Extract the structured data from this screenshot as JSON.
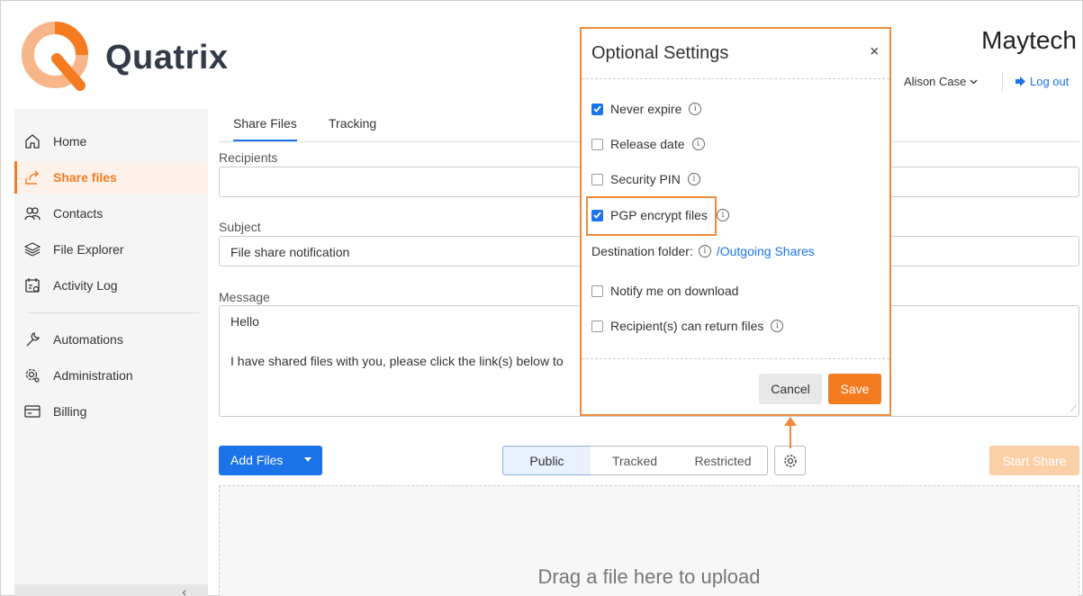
{
  "app": {
    "logo_text": "Quatrix",
    "brand": "Maytech",
    "user_name": "Alison Case",
    "logout_label": "Log out"
  },
  "sidebar": {
    "items": [
      {
        "label": "Home",
        "icon": "home-icon"
      },
      {
        "label": "Share files",
        "icon": "share-icon",
        "active": true
      },
      {
        "label": "Contacts",
        "icon": "contacts-icon"
      },
      {
        "label": "File Explorer",
        "icon": "layers-icon"
      },
      {
        "label": "Activity Log",
        "icon": "activity-log-icon"
      },
      {
        "label": "Automations",
        "icon": "wrench-icon"
      },
      {
        "label": "Administration",
        "icon": "gear-icon"
      },
      {
        "label": "Billing",
        "icon": "billing-icon"
      }
    ],
    "collapse_glyph": "‹"
  },
  "tabs": [
    {
      "label": "Share Files",
      "active": true
    },
    {
      "label": "Tracking"
    }
  ],
  "form": {
    "recipients_label": "Recipients",
    "recipients_value": "",
    "subject_label": "Subject",
    "subject_value": "File share notification",
    "message_label": "Message",
    "message_line1": "Hello",
    "message_line2": "I have shared files with you, please click the link(s) below to"
  },
  "actions": {
    "add_files": "Add Files",
    "segments": [
      "Public",
      "Tracked",
      "Restricted"
    ],
    "active_segment": "Public",
    "start_share": "Start Share",
    "dropzone_text": "Drag a file here to upload"
  },
  "modal": {
    "title": "Optional Settings",
    "close_glyph": "×",
    "options": [
      {
        "label": "Never expire",
        "checked": true,
        "info": true
      },
      {
        "label": "Release date",
        "checked": false,
        "info": true
      },
      {
        "label": "Security PIN",
        "checked": false,
        "info": true
      },
      {
        "label": "PGP encrypt files",
        "checked": true,
        "info": true
      }
    ],
    "destination_label": "Destination folder:",
    "destination_value": "/Outgoing Shares",
    "notify_label": "Notify me on download",
    "notify_checked": false,
    "return_label": "Recipient(s) can return files",
    "return_checked": false,
    "cancel_label": "Cancel",
    "save_label": "Save"
  },
  "colors": {
    "accent": "#f57b20",
    "primary": "#1a73e8",
    "highlight": "#f08a3a"
  }
}
